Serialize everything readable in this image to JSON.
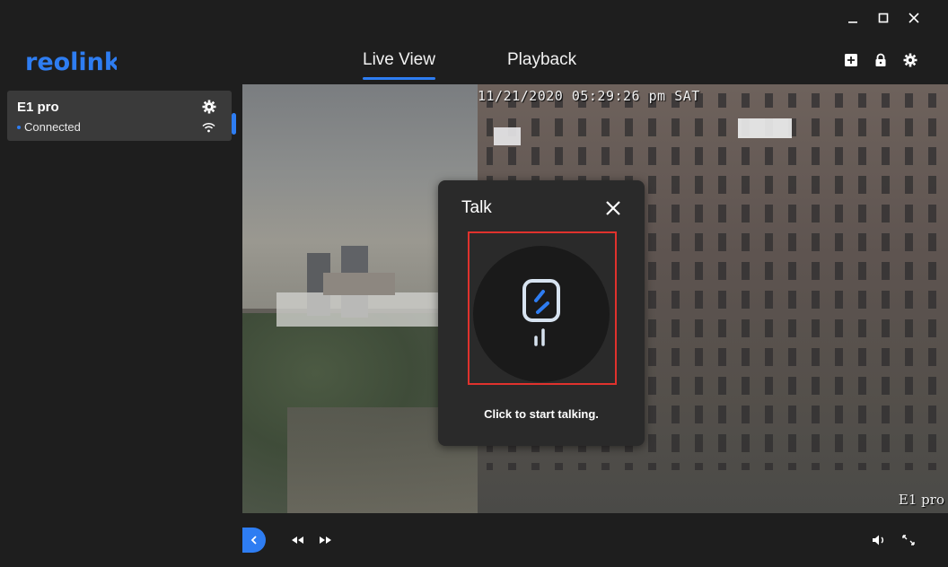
{
  "app": {
    "brand": "reolink"
  },
  "window": {
    "minimize_icon": "minimize-icon",
    "maximize_icon": "maximize-icon",
    "close_icon": "close-icon"
  },
  "header": {
    "tabs": [
      {
        "label": "Live View",
        "active": true
      },
      {
        "label": "Playback",
        "active": false
      }
    ],
    "icons": [
      "add-device-icon",
      "lock-icon",
      "settings-gear-icon"
    ]
  },
  "sidebar": {
    "devices": [
      {
        "name": "E1 pro",
        "status": "Connected",
        "status_color": "#2e7df2"
      }
    ]
  },
  "video": {
    "timestamp": "11/21/2020 05:29:26 pm SAT",
    "camera_label": "E1 pro"
  },
  "talk_dialog": {
    "title": "Talk",
    "hint": "Click to start talking.",
    "highlight_color": "#e0322d"
  },
  "bottombar": {
    "icons": [
      "collapse-sidebar-icon",
      "rewind-icon",
      "fast-forward-icon",
      "volume-icon",
      "fullscreen-icon"
    ]
  },
  "colors": {
    "accent": "#2e7df2",
    "background": "#1e1e1e",
    "card": "#3a3a3a"
  }
}
